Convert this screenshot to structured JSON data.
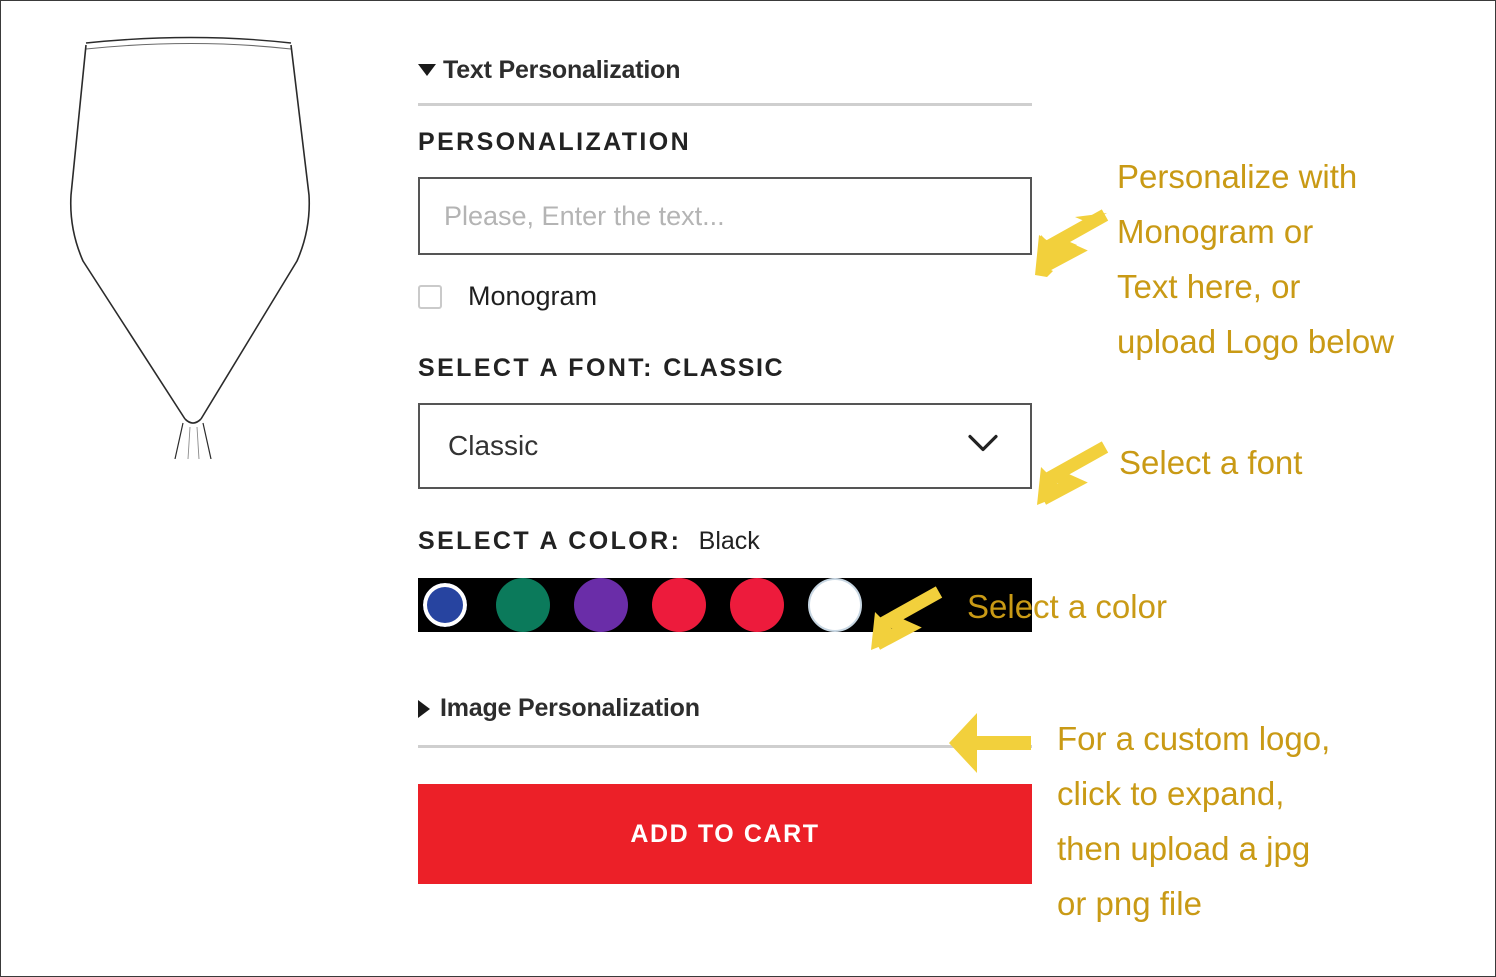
{
  "product": {
    "image_alt": "wine-glass-outline"
  },
  "panel": {
    "text_personalization": {
      "title": "Text Personalization",
      "toggle_icon": "caret-down-icon",
      "expanded": true
    },
    "personalization": {
      "label": "PERSONALIZATION",
      "input_value": "",
      "input_placeholder": "Please, Enter the text...",
      "monogram_label": "Monogram",
      "monogram_checked": false
    },
    "font": {
      "label": "SELECT A FONT:",
      "selected_upper": "CLASSIC",
      "selected": "Classic",
      "chevron_icon": "chevron-down-icon",
      "options": [
        "Classic"
      ]
    },
    "color": {
      "label": "SELECT A COLOR:",
      "selected_name": "Black",
      "swatches": [
        {
          "name": "Black",
          "hex": "#000000",
          "selected": true,
          "outline": false
        },
        {
          "name": "Blue",
          "hex": "#2744A0",
          "selected": false,
          "outline": false
        },
        {
          "name": "Green",
          "hex": "#0B7A5B",
          "selected": false,
          "outline": false
        },
        {
          "name": "Purple",
          "hex": "#6A2DA8",
          "selected": false,
          "outline": false
        },
        {
          "name": "Red",
          "hex": "#ED1B3C",
          "selected": false,
          "outline": false
        },
        {
          "name": "White",
          "hex": "#FFFFFF",
          "selected": false,
          "outline": true
        }
      ]
    },
    "image_personalization": {
      "title": "Image Personalization",
      "toggle_icon": "caret-right-icon",
      "expanded": false
    },
    "add_to_cart_label": "ADD TO CART"
  },
  "annotations": {
    "text_color": "#C99A15",
    "arrow_color": "#F2D03C",
    "callout_1": "Personalize with\nMonogram or\nText here, or\nupload Logo below",
    "callout_2": "Select a font",
    "callout_3": "Select a color",
    "callout_4": "For a custom logo,\nclick to expand,\nthen upload a jpg\nor png file",
    "arrow_1_icon": "arrow-down-left-icon",
    "arrow_2_icon": "arrow-down-left-icon",
    "arrow_3_icon": "arrow-down-left-icon",
    "arrow_4_icon": "arrow-left-icon"
  }
}
